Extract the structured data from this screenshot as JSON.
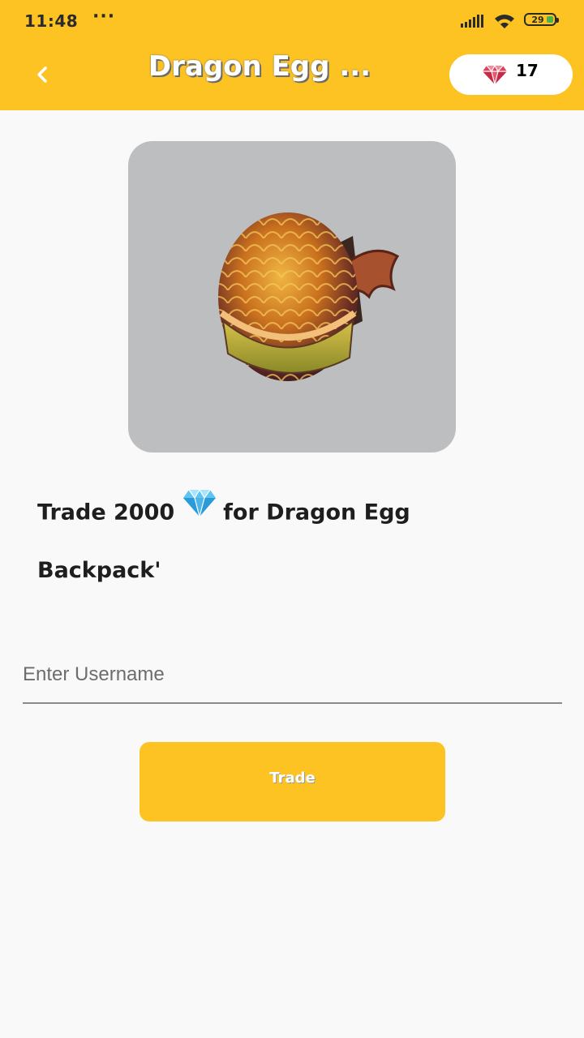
{
  "status_bar": {
    "time": "11:48",
    "dots": "···",
    "battery": "29",
    "icons": [
      "signal-icon",
      "wifi-icon",
      "battery-icon"
    ]
  },
  "header": {
    "title": "Dragon Egg ...",
    "back_icon": "chevron-left-icon",
    "gem_count": "17",
    "gem_icon": "red-gem-icon",
    "background_color": "#fdc323"
  },
  "item": {
    "image_icon": "dragon-egg-backpack-image",
    "image_background": "#bdbec0"
  },
  "trade_info": {
    "prefix": "Trade 2000",
    "gem_icon": "blue-diamond-icon",
    "suffix": "for Dragon Egg",
    "line2": "Backpack'"
  },
  "form": {
    "username_placeholder": "Enter Username",
    "username_value": ""
  },
  "action": {
    "trade_label": "Trade",
    "button_color": "#fdc323"
  }
}
